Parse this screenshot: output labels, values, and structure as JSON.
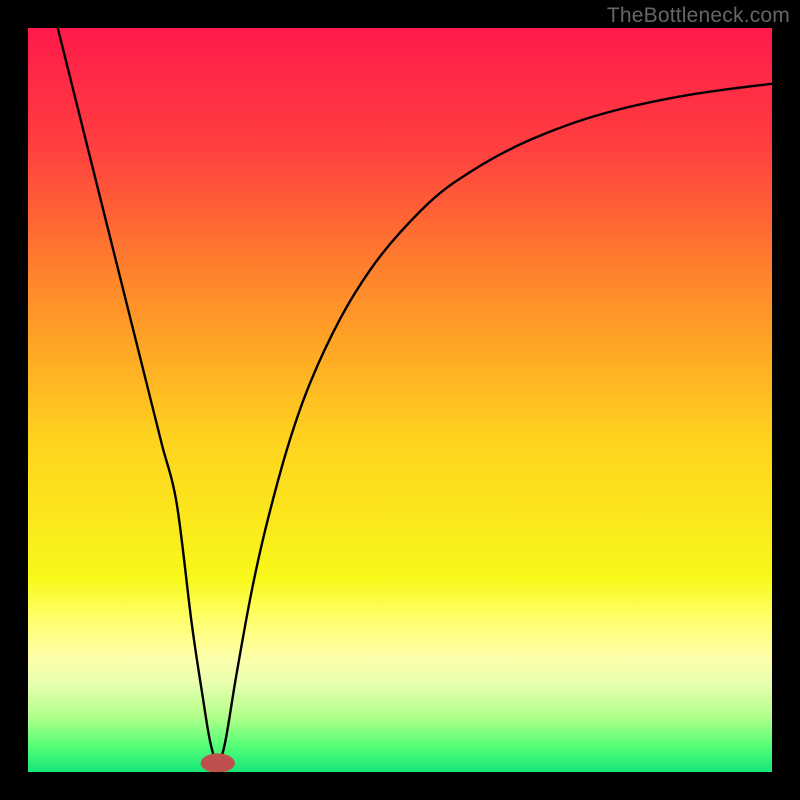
{
  "watermark": "TheBottleneck.com",
  "chart_data": {
    "type": "line",
    "title": "",
    "xlabel": "",
    "ylabel": "",
    "xlim": [
      0,
      100
    ],
    "ylim": [
      0,
      100
    ],
    "background_gradient": {
      "stops": [
        {
          "offset": 0.0,
          "color": "#ff1a4b"
        },
        {
          "offset": 0.16,
          "color": "#ff3f3f"
        },
        {
          "offset": 0.35,
          "color": "#ff8a2a"
        },
        {
          "offset": 0.55,
          "color": "#ffd21f"
        },
        {
          "offset": 0.74,
          "color": "#f8f81a"
        },
        {
          "offset": 0.79,
          "color": "#ffff66"
        },
        {
          "offset": 0.845,
          "color": "#ffffaa"
        },
        {
          "offset": 0.88,
          "color": "#e8ffb0"
        },
        {
          "offset": 0.925,
          "color": "#b3ff8a"
        },
        {
          "offset": 0.965,
          "color": "#55ff77"
        },
        {
          "offset": 1.0,
          "color": "#16e57a"
        }
      ]
    },
    "series": [
      {
        "name": "bottleneck-curve",
        "color": "#000000",
        "width": 2.4,
        "x": [
          4,
          6,
          8,
          10,
          12,
          14,
          16,
          18,
          20,
          22,
          23.5,
          24.5,
          25.5,
          26.5,
          28,
          30,
          32,
          35,
          38,
          42,
          46,
          50,
          55,
          60,
          65,
          70,
          75,
          80,
          85,
          90,
          95,
          100
        ],
        "y": [
          100,
          92,
          84,
          76,
          68,
          60,
          52,
          44,
          36,
          20,
          10,
          4,
          1.2,
          4,
          13,
          24,
          33,
          44,
          52.5,
          61,
          67.5,
          72.5,
          77.5,
          81,
          83.8,
          86,
          87.8,
          89.2,
          90.3,
          91.2,
          91.9,
          92.5
        ]
      }
    ],
    "marker": {
      "name": "min-marker",
      "shape": "rounded-capsule",
      "color": "#c0504d",
      "cx": 25.5,
      "cy": 1.2,
      "rx": 2.3,
      "ry": 1.3
    }
  }
}
